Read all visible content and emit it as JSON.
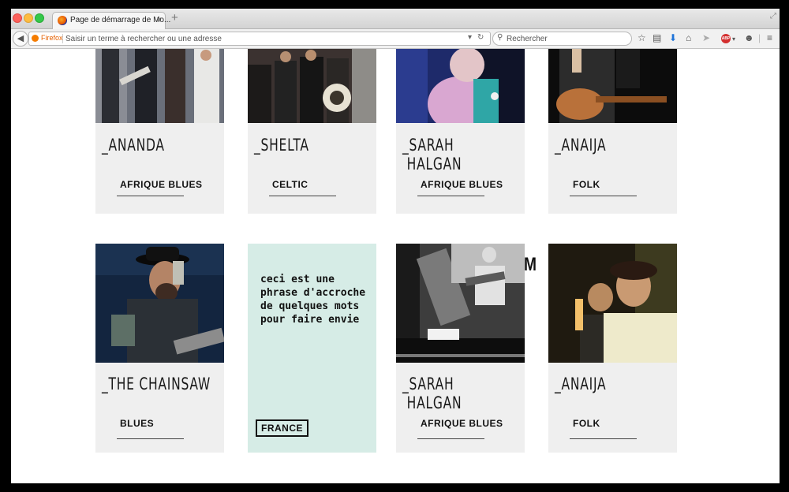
{
  "browser": {
    "tab_title": "Page de démarrage de Mo...",
    "tab_close": "×",
    "new_tab": "+",
    "url_brand": "Firefox",
    "url_placeholder": "Saisir un terme à rechercher ou une adresse",
    "search_placeholder": "Rechercher",
    "abp_label": "ABP"
  },
  "cards": [
    {
      "name": "_ANANDA",
      "genre": "AFRIQUE BLUES"
    },
    {
      "name": "_SHELTA",
      "genre": "CELTIC"
    },
    {
      "name": "_SARAH\n HALGAN",
      "genre": "AFRIQUE BLUES"
    },
    {
      "name": "_ANAIJA",
      "genre": "FOLK"
    },
    {
      "name": "_THE CHAINSAW",
      "genre": "BLUES"
    },
    {
      "name": "_SARAH\n HALGAN",
      "genre": "AFRIQUE BLUES"
    },
    {
      "name": "_ANAIJA",
      "genre": "FOLK"
    }
  ],
  "promo": {
    "text": "ceci est une phrase d'accroche de quelques mots pour faire envie",
    "badge": "FRANCE"
  },
  "stray_glyph": "M"
}
